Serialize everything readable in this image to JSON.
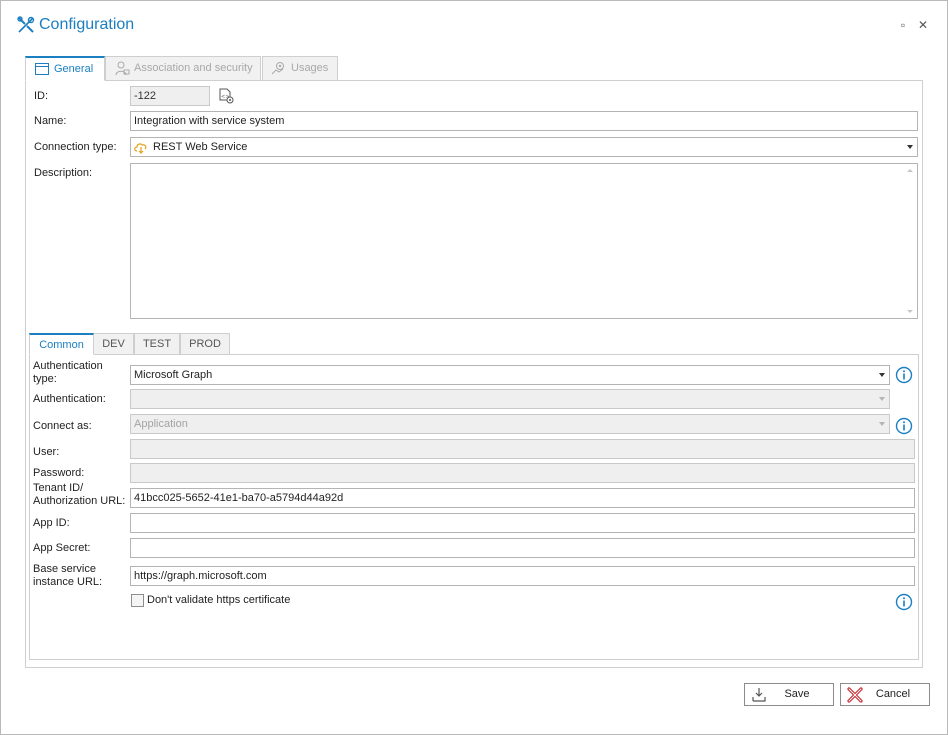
{
  "window": {
    "title": "Configuration",
    "icons": {
      "title": "tools-icon",
      "maximize": "maximize-icon",
      "close": "close-icon"
    },
    "maximize_glyph": "▫",
    "close_glyph": "✕"
  },
  "tabs": [
    {
      "label": "General",
      "icon": "window-icon",
      "active": true
    },
    {
      "label": "Association and security",
      "icon": "user-lock-icon",
      "active": false
    },
    {
      "label": "Usages",
      "icon": "gear-chart-icon",
      "active": false
    }
  ],
  "general": {
    "id_label": "ID:",
    "id_value": "-122",
    "name_label": "Name:",
    "name_value": "Integration with service system",
    "connection_type_label": "Connection type:",
    "connection_type_value": "REST Web Service",
    "description_label": "Description:",
    "description_value": ""
  },
  "subtabs": [
    {
      "label": "Common",
      "active": true
    },
    {
      "label": "DEV",
      "active": false
    },
    {
      "label": "TEST",
      "active": false
    },
    {
      "label": "PROD",
      "active": false
    }
  ],
  "common": {
    "auth_type_label_1": "Authentication",
    "auth_type_label_2": "type:",
    "auth_type_value": "Microsoft Graph",
    "authentication_label": "Authentication:",
    "authentication_value": "",
    "connect_as_label": "Connect as:",
    "connect_as_value": "Application",
    "user_label": "User:",
    "user_value": "",
    "password_label": "Password:",
    "password_value": "",
    "tenant_label_1": "Tenant ID/",
    "tenant_label_2": "Authorization URL:",
    "tenant_value": "41bcc025-5652-41e1-ba70-a5794d44a92d",
    "app_id_label": "App ID:",
    "app_id_value": "",
    "app_secret_label": "App Secret:",
    "app_secret_value": "",
    "base_url_label_1": "Base service",
    "base_url_label_2": "instance URL:",
    "base_url_value": "https://graph.microsoft.com",
    "dont_validate_label": "Don't validate https certificate",
    "dont_validate_checked": false
  },
  "buttons": {
    "save_label": "Save",
    "cancel_label": "Cancel"
  },
  "colors": {
    "accent": "#1b7fc1",
    "cancel_icon": "#c8232c",
    "cloud_icon": "#e3a21a"
  }
}
